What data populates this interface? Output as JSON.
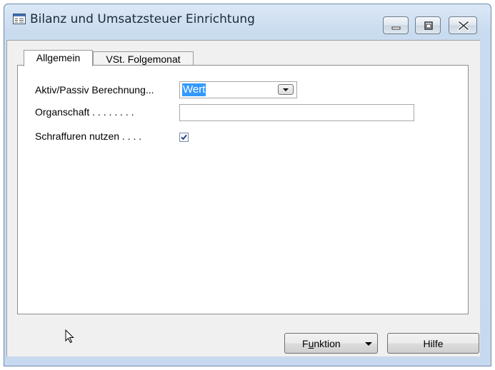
{
  "window": {
    "title": "Bilanz und Umsatzsteuer Einrichtung",
    "controls": [
      "minimize-icon",
      "maximize-icon",
      "close-icon"
    ]
  },
  "tabs": [
    {
      "label": "Allgemein",
      "active": true
    },
    {
      "label": "VSt. Folgemonat",
      "active": false
    }
  ],
  "form": {
    "fields": [
      {
        "label": "Aktiv/Passiv Berechnung...",
        "type": "select",
        "value": "Wert"
      },
      {
        "label": "Organschaft . . . . . . . .",
        "type": "text",
        "value": ""
      },
      {
        "label": "Schraffuren nutzen . . . .",
        "type": "checkbox",
        "checked": true
      }
    ]
  },
  "buttons": {
    "funktion_pre": "F",
    "funktion_key": "u",
    "funktion_post": "nktion",
    "hilfe": "Hilfe"
  },
  "colors": {
    "selection": "#3399ff",
    "titlebar": "#c9dbef",
    "dialog": "#f0f0f0"
  }
}
